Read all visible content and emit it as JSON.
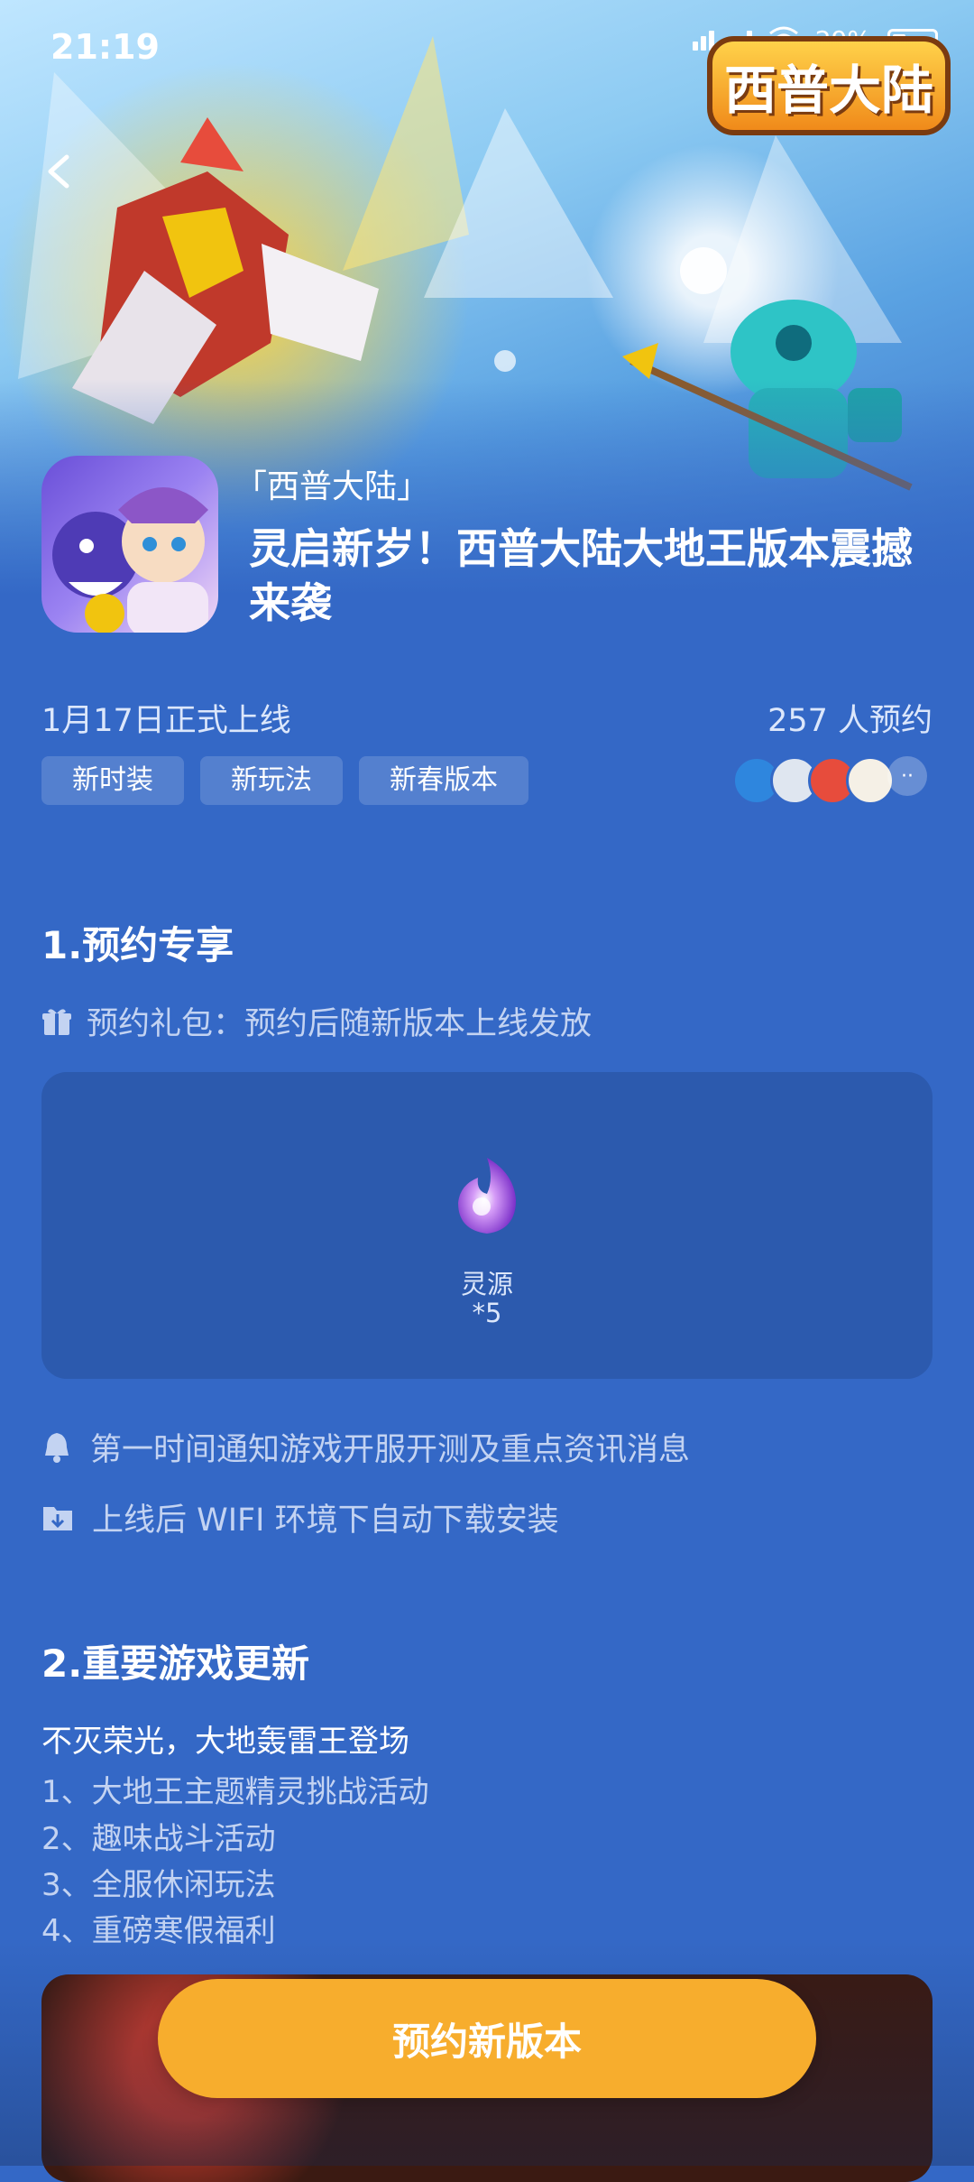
{
  "status_bar": {
    "time": "21:19",
    "net1": "4G",
    "net2": "5G",
    "battery": "29%"
  },
  "header": {
    "game_logo_text": "西普大陆",
    "bracket_title": "「西普大陆」",
    "title": "灵启新岁！西普大陆大地王版本震撼来袭"
  },
  "meta": {
    "launch": "1月17日正式上线",
    "reservations": "257 人预约",
    "tags": [
      "新时装",
      "新玩法",
      "新春版本"
    ]
  },
  "section1": {
    "title": "1.预约专享",
    "gift_text": "预约礼包：预约后随新版本上线发放",
    "gift_item_name": "灵源",
    "gift_item_count": "*5",
    "notify_text": "第一时间通知游戏开服开测及重点资讯消息",
    "download_text": "上线后 WIFI 环境下自动下载安装"
  },
  "section2": {
    "title": "2.重要游戏更新",
    "headline": "不灭荣光，大地轰雷王登场",
    "items": [
      "1、大地王主题精灵挑战活动",
      "2、趣味战斗活动",
      "3、全服休闲玩法",
      "4、重磅寒假福利"
    ]
  },
  "cta": {
    "label": "预约新版本"
  },
  "colors": {
    "background": "#3468c6",
    "card": "#2c5aae",
    "cta": "#f7ad2d",
    "muted_text": "#c3d3f2"
  },
  "icons": [
    "back-arrow-icon",
    "gift-icon",
    "bell-icon",
    "download-folder-icon",
    "flame-orb-icon"
  ]
}
